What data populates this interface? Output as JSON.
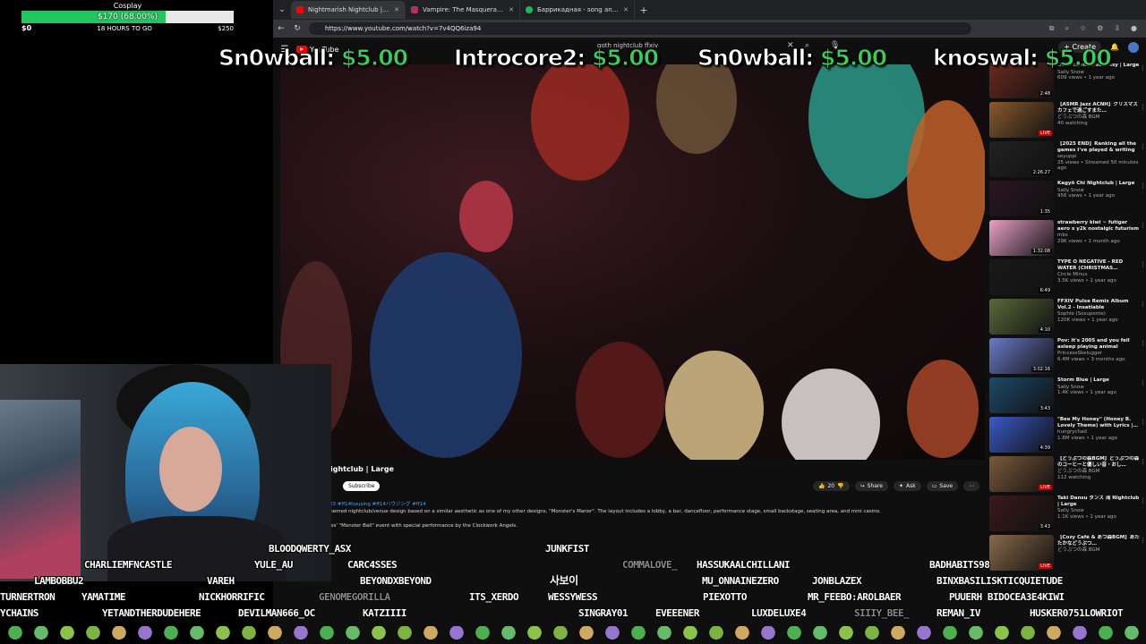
{
  "goal": {
    "title": "Cosplay",
    "label": "$170 (68.00%)",
    "progress": 0.68,
    "min": "$0",
    "remaining": "18 HOURS TO GO",
    "max": "$250",
    "fill_color": "#22c55e"
  },
  "browser": {
    "tabs": [
      {
        "title": "Nightmarish Nightclub | Larg",
        "favicon": "youtube-icon",
        "color": "#ff0000",
        "active": true
      },
      {
        "title": "Vampire: The Masquerade Clan Te",
        "favicon": "vampire-icon",
        "color": "#b03060",
        "active": false
      },
      {
        "title": "Баррикадная - song and lyrics by",
        "favicon": "spotify-icon",
        "color": "#1db954",
        "active": false
      }
    ],
    "url": "https://www.youtube.com/watch?v=7v4QQ6iza94"
  },
  "youtube": {
    "logo": "YouTube",
    "search_query": "goth nightclub ffxiv",
    "create_label": "Create",
    "video_title": "ightclub | Large",
    "subscribe_label": "Subscribe",
    "actions": {
      "likes": "20",
      "share": "Share",
      "ask": "Ask",
      "save": "Save"
    },
    "description": {
      "tags": "2023  #ff14housing #ff14ハウジング #ff14",
      "line1": "y-themed nightclub/venue design based on a similar aesthetic as one of my other designs, \"Monster's Manor\". The layout includes a lobby, a bar, dancefloor, performance stage, small backstage,  seating area, and mini casino.",
      "line2": "Lines' \"Monster Ball\" event with special performance by the Clockwork Angels."
    }
  },
  "related": [
    {
      "title": "Downtown Speakeasy | Large",
      "channel": "Sally Snow",
      "stats": "609 views • 1 year ago",
      "duration": "2:48",
      "live": false,
      "color": "#6b2a1e"
    },
    {
      "title": "【ASMR Jazz ACNH】クリスマスカフェで過ごすまた…",
      "channel": "どうぶつの森 BGM",
      "stats": "40 watching",
      "duration": "LIVE",
      "live": true,
      "color": "#8a5a2e"
    },
    {
      "title": "【2025 END】Ranking all the games I've played & writing a…",
      "channel": "seyuppi",
      "stats": "25 views • Streamed 50 minutes ago",
      "duration": "2:26:27",
      "live": false,
      "color": "#222"
    },
    {
      "title": "Kagyō Chi Nightclub | Large",
      "channel": "Sally Snow",
      "stats": "956 views • 1 year ago",
      "duration": "1:35",
      "live": false,
      "color": "#2a1620"
    },
    {
      "title": "strawberry kiwi ~ futiger aero x y2k nostalgic futurism ~…",
      "channel": "mbs",
      "stats": "29K views • 1 month ago",
      "duration": "1:32:08",
      "live": false,
      "color": "#e8a0c8"
    },
    {
      "title": "TYPE O NEGATIVE - RED WATER (CHRISTMAS…",
      "channel": "Circle Minus",
      "stats": "3.5K views • 1 year ago",
      "duration": "6:49",
      "live": false,
      "color": "#1a1a1a"
    },
    {
      "title": "FFXIV Pulse Remix Album Vol.2 - Insatiable (Shadowbringers…",
      "channel": "Sophie (Sosuponte)",
      "stats": "120K views • 1 year ago",
      "duration": "4:10",
      "live": false,
      "color": "#5a6a3a"
    },
    {
      "title": "Pov: it's 2005 and you fell asleep playing animal crossing",
      "channel": "PrincessSkelugger",
      "stats": "6.4M views • 3 months ago",
      "duration": "3:02:16",
      "live": false,
      "color": "#6a7ac8"
    },
    {
      "title": "Storm Blue | Large",
      "channel": "Sally Snow",
      "stats": "1.4K views • 1 year ago",
      "duration": "3:43",
      "live": false,
      "color": "#1c4a6a"
    },
    {
      "title": "\"Bee My Honey\" (Honey B. Lovely Theme) with Lyrics |…",
      "channel": "hungrychad",
      "stats": "1.8M views • 1 year ago",
      "duration": "4:39",
      "live": false,
      "color": "#3a5ac8"
    },
    {
      "title": "【どうぶつの森BGM】どうぶつの森のコーヒーと優しい音・おし…",
      "channel": "どうぶつの森 BGM",
      "stats": "112 watching",
      "duration": "LIVE",
      "live": true,
      "color": "#7a5a3a"
    },
    {
      "title": "Taki Dansu ダンス 滝 Nightclub | Large",
      "channel": "Sally Snow",
      "stats": "1.1K views • 1 year ago",
      "duration": "3:43",
      "live": false,
      "color": "#3a1a1a"
    },
    {
      "title": "【Cozy Café & あつ森BGM】あたたかなどうぶつ…",
      "channel": "どうぶつの森 BGM",
      "stats": "",
      "duration": "LIVE",
      "live": true,
      "color": "#8a6a4a"
    }
  ],
  "donations": [
    {
      "name": "Sn0wball:",
      "amount": "$5.00"
    },
    {
      "name": "Introcore2:",
      "amount": "$5.00"
    },
    {
      "name": "Sn0wball:",
      "amount": "$5.00"
    },
    {
      "name": "knoswal:",
      "amount": "$5.00"
    }
  ],
  "chatters": [
    {
      "name": "BLOODQWERTY_ASX",
      "dim": false
    },
    {
      "name": "JUNKFIST",
      "dim": false
    },
    {
      "name": "CHARLIEMFNCASTLE",
      "dim": false
    },
    {
      "name": "YULE_AU",
      "dim": false
    },
    {
      "name": "CARC4SSES",
      "dim": false
    },
    {
      "name": "COMMALOVE_",
      "dim": true
    },
    {
      "name": "HASSUKAALCHILLANI",
      "dim": false
    },
    {
      "name": "BADHABITS98",
      "dim": false
    },
    {
      "name": "LAMBOBBU2",
      "dim": false
    },
    {
      "name": "VAREH",
      "dim": false
    },
    {
      "name": "BEYONDXBEYOND",
      "dim": false
    },
    {
      "name": "MU_ONNAINEZERO",
      "dim": false
    },
    {
      "name": "JONBLAZEX",
      "dim": false
    },
    {
      "name": "BINXBASILISKTICQUIETUDE",
      "dim": false
    },
    {
      "name": "TURNERTRON",
      "dim": false
    },
    {
      "name": "YAMATIME",
      "dim": false
    },
    {
      "name": "NICKHORRIFIC",
      "dim": false
    },
    {
      "name": "GENOMEGORILLA",
      "dim": true
    },
    {
      "name": "ITS_XERDO",
      "dim": false
    },
    {
      "name": "WESSYWESS",
      "dim": false
    },
    {
      "name": "PIEXOTTO",
      "dim": false
    },
    {
      "name": "MR_FEEBO:AROLBAER",
      "dim": false
    },
    {
      "name": "PUUERH BIDOCEA3E4KIWI",
      "dim": false
    },
    {
      "name": "YCHAINS",
      "dim": false
    },
    {
      "name": "YETANDTHERDUDEHERE",
      "dim": false
    },
    {
      "name": "DEVILMAN666_OC",
      "dim": false
    },
    {
      "name": "KATZIIII",
      "dim": false
    },
    {
      "name": "SINGRAY01",
      "dim": false
    },
    {
      "name": "EVEEENER",
      "dim": false
    },
    {
      "name": "LUXDELUXE4",
      "dim": false
    },
    {
      "name": "SIIIY_BEE_",
      "dim": true
    },
    {
      "name": "REMAN_IV",
      "dim": false
    },
    {
      "name": "HUSKER0751LOWRIOT",
      "dim": false
    }
  ],
  "overlay_badge": "사보이"
}
